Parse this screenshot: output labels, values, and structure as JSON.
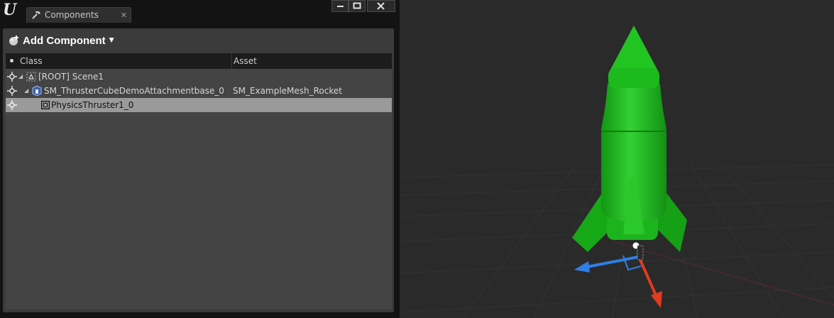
{
  "window": {
    "tab_label": "Components",
    "tab_close": "✕",
    "buttons": {
      "minimize": "minimize-icon",
      "maximize": "maximize-icon",
      "close": "close-icon"
    }
  },
  "toolbar": {
    "add_component_label": "Add Component"
  },
  "list": {
    "columns": {
      "class": "Class",
      "asset": "Asset"
    },
    "rows": [
      {
        "label": "[ROOT] Scene1",
        "asset": ""
      },
      {
        "label": "SM_ThrusterCubeDemoAttachmentbase_0",
        "asset": "SM_ExampleMesh_Rocket"
      },
      {
        "label": "PhysicsThruster1_0",
        "asset": ""
      }
    ]
  },
  "viewport": {
    "object": "green-rocket-mesh",
    "colors": {
      "rocket": "#1fc21f",
      "gizmo_x": "#e23b1e",
      "gizmo_y": "#2f7fe6",
      "gizmo_z": "#2fd02f"
    }
  }
}
